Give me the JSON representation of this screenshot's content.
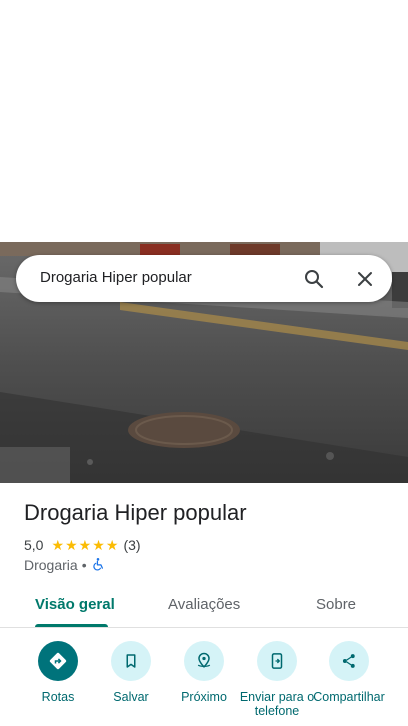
{
  "search": {
    "query": "Drogaria Hiper popular"
  },
  "place": {
    "name": "Drogaria Hiper popular",
    "rating": "5,0",
    "stars": 5,
    "review_count": "(3)",
    "category": "Drogaria",
    "separator": "•"
  },
  "tabs": [
    {
      "label": "Visão geral",
      "active": true
    },
    {
      "label": "Avaliações",
      "active": false
    },
    {
      "label": "Sobre",
      "active": false
    }
  ],
  "actions": [
    {
      "label": "Rotas",
      "icon": "directions-icon"
    },
    {
      "label": "Salvar",
      "icon": "bookmark-icon"
    },
    {
      "label": "Próximo",
      "icon": "nearby-icon"
    },
    {
      "label": "Enviar para o telefone",
      "icon": "send-to-phone-icon"
    },
    {
      "label": "Compartilhar",
      "icon": "share-icon"
    }
  ],
  "colors": {
    "accent": "#00796b",
    "primary_action": "#00737b",
    "action_bg": "#d5f3f7",
    "star": "#fbbc04"
  }
}
